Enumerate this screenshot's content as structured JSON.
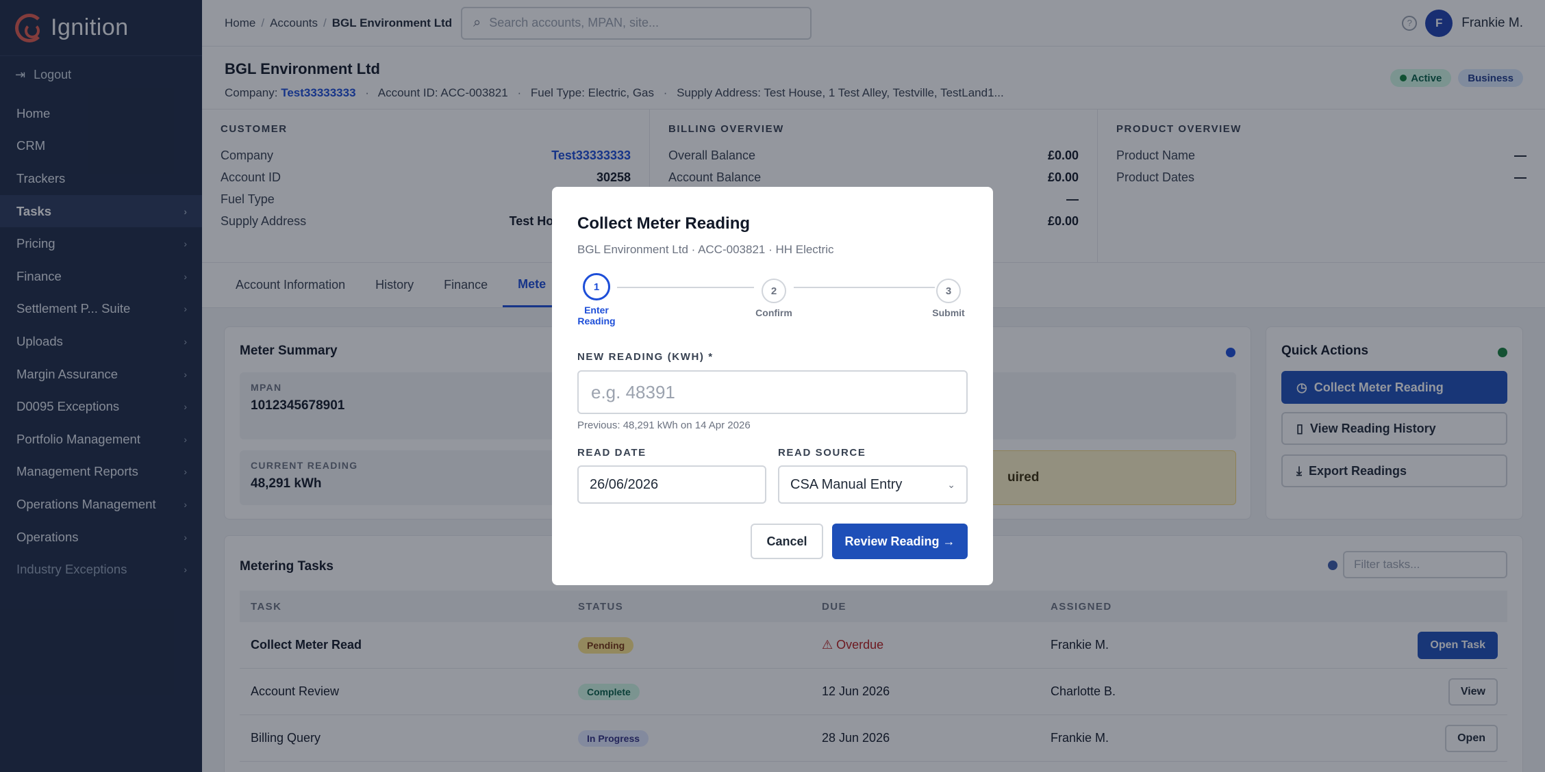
{
  "brand": {
    "name": "Ignition"
  },
  "sidebar": {
    "logout": "Logout",
    "items": [
      {
        "label": "Home"
      },
      {
        "label": "CRM"
      },
      {
        "label": "Trackers"
      },
      {
        "label": "Tasks"
      },
      {
        "label": "Pricing"
      },
      {
        "label": "Finance"
      },
      {
        "label": "Settlement P... Suite"
      },
      {
        "label": "Uploads"
      },
      {
        "label": "Margin Assurance"
      },
      {
        "label": "D0095 Exceptions"
      },
      {
        "label": "Portfolio Management"
      },
      {
        "label": "Management Reports"
      },
      {
        "label": "Operations Management"
      },
      {
        "label": "Operations"
      },
      {
        "label": "Industry Exceptions"
      }
    ]
  },
  "topbar": {
    "breadcrumb": [
      "Home",
      "Accounts",
      "BGL Environment Ltd"
    ],
    "search_placeholder": "Search accounts, MPAN, site...",
    "avatar_initial": "F",
    "username": "Frankie M."
  },
  "account": {
    "title": "BGL Environment Ltd",
    "company_label": "Company:",
    "company": "Test33333333",
    "account_id": "Account ID: ACC-003821",
    "fuel_type": "Fuel Type: Electric, Gas",
    "supply_address": "Supply Address: Test House, 1 Test Alley, Testville, TestLand1...",
    "badges": [
      "Active",
      "Business"
    ]
  },
  "overview": {
    "customer": {
      "heading": "CUSTOMER",
      "rows": [
        {
          "label": "Company",
          "value": "Test33333333"
        },
        {
          "label": "Account ID",
          "value": "30258"
        },
        {
          "label": "Fuel Type",
          "value": ""
        },
        {
          "label": "Supply Address",
          "value": "Test House, 1 Test Alley,"
        }
      ]
    },
    "billing": {
      "heading": "BILLING OVERVIEW",
      "rows": [
        {
          "label": "Overall Balance",
          "value": "£0.00"
        },
        {
          "label": "Account Balance",
          "value": "£0.00"
        },
        {
          "label": "",
          "value": "—"
        },
        {
          "label": "",
          "value": "£0.00"
        }
      ]
    },
    "product": {
      "heading": "PRODUCT OVERVIEW",
      "rows": [
        {
          "label": "Product Name",
          "value": "—"
        },
        {
          "label": "Product Dates",
          "value": "—"
        }
      ]
    }
  },
  "tabs": [
    "Account Information",
    "History",
    "Finance",
    "Mete"
  ],
  "meter_summary": {
    "title": "Meter Summary",
    "mpan_label": "MPAN",
    "mpan": "1012345678901",
    "current_label": "CURRENT READING",
    "current": "48,291 kWh",
    "warning": "uired"
  },
  "quick_actions": {
    "title": "Quick Actions",
    "buttons": [
      "Collect Meter Reading",
      "View Reading History",
      "Export Readings"
    ]
  },
  "tasks": {
    "title": "Metering Tasks",
    "filter_placeholder": "Filter tasks...",
    "columns": [
      "TASK",
      "STATUS",
      "DUE",
      "ASSIGNED"
    ],
    "rows": [
      {
        "task": "Collect Meter Read",
        "status": "Pending",
        "due": "Overdue",
        "assigned": "Frankie M.",
        "action": "Open Task"
      },
      {
        "task": "Account Review",
        "status": "Complete",
        "due": "12 Jun 2026",
        "assigned": "Charlotte B.",
        "action": "View"
      },
      {
        "task": "Billing Query",
        "status": "In Progress",
        "due": "28 Jun 2026",
        "assigned": "Frankie M.",
        "action": "Open"
      }
    ]
  },
  "modal": {
    "title": "Collect Meter Reading",
    "subtitle": "BGL Environment Ltd · ACC-003821 · HH Electric",
    "steps": [
      {
        "num": "1",
        "label": "Enter Reading"
      },
      {
        "num": "2",
        "label": "Confirm"
      },
      {
        "num": "3",
        "label": "Submit"
      }
    ],
    "reading_label": "NEW READING (KWH) *",
    "reading_placeholder": "e.g. 48391",
    "reading_hint": "Previous: 48,291 kWh on 14 Apr 2026",
    "date_label": "READ DATE",
    "date_value": "26/06/2026",
    "source_label": "READ SOURCE",
    "source_value": "CSA Manual Entry",
    "cancel": "Cancel",
    "review": "Review Reading →"
  },
  "colors": {
    "sidebar_bg": "#1e2a45",
    "primary": "#1e4fb8",
    "accent_logo": "#e05a4e"
  }
}
